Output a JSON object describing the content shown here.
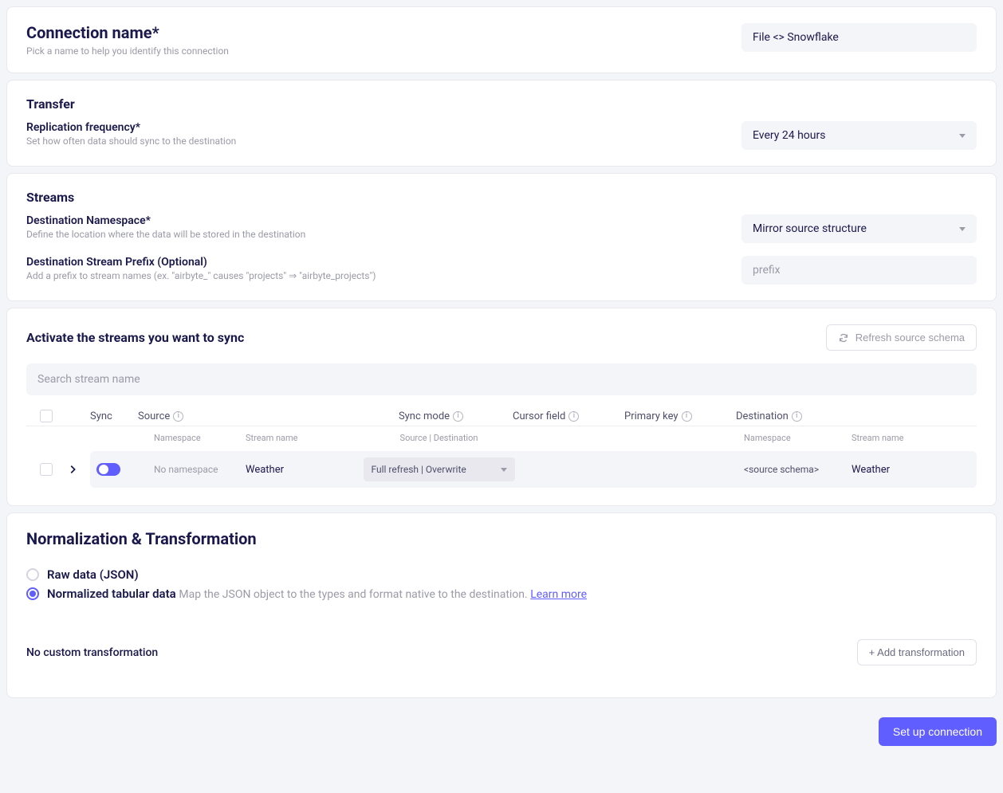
{
  "connection": {
    "title": "Connection name*",
    "help": "Pick a name to help you identify this connection",
    "value": "File <> Snowflake"
  },
  "transfer": {
    "title": "Transfer",
    "freq_label": "Replication frequency*",
    "freq_help": "Set how often data should sync to the destination",
    "freq_value": "Every 24 hours"
  },
  "streams_section": {
    "title": "Streams",
    "ns_label": "Destination Namespace*",
    "ns_help": "Define the location where the data will be stored in the destination",
    "ns_value": "Mirror source structure",
    "prefix_label": "Destination Stream Prefix (Optional)",
    "prefix_help": "Add a prefix to stream names (ex. \"airbyte_\" causes \"projects\" ⇒ \"airbyte_projects\")",
    "prefix_placeholder": "prefix"
  },
  "activate": {
    "title": "Activate the streams you want to sync",
    "refresh_label": "Refresh source schema",
    "search_placeholder": "Search stream name",
    "columns": {
      "sync": "Sync",
      "source": "Source",
      "mode": "Sync mode",
      "cursor": "Cursor field",
      "pk": "Primary key",
      "dest": "Destination"
    },
    "subcolumns": {
      "namespace": "Namespace",
      "stream_name": "Stream name",
      "mode": "Source | Destination",
      "dest_namespace": "Namespace",
      "dest_stream_name": "Stream name"
    },
    "row": {
      "no_namespace": "No namespace",
      "stream_name": "Weather",
      "mode": "Full refresh  |  Overwrite",
      "dest_namespace": "<source schema>",
      "dest_stream_name": "Weather"
    }
  },
  "normalization": {
    "title": "Normalization & Transformation",
    "raw_label": "Raw data (JSON)",
    "norm_label": "Normalized tabular data",
    "norm_help": "Map the JSON object to the types and format native to the destination.",
    "learn_more": "Learn more",
    "no_custom": "No custom transformation",
    "add_btn": "+ Add transformation"
  },
  "footer": {
    "setup": "Set up connection"
  }
}
